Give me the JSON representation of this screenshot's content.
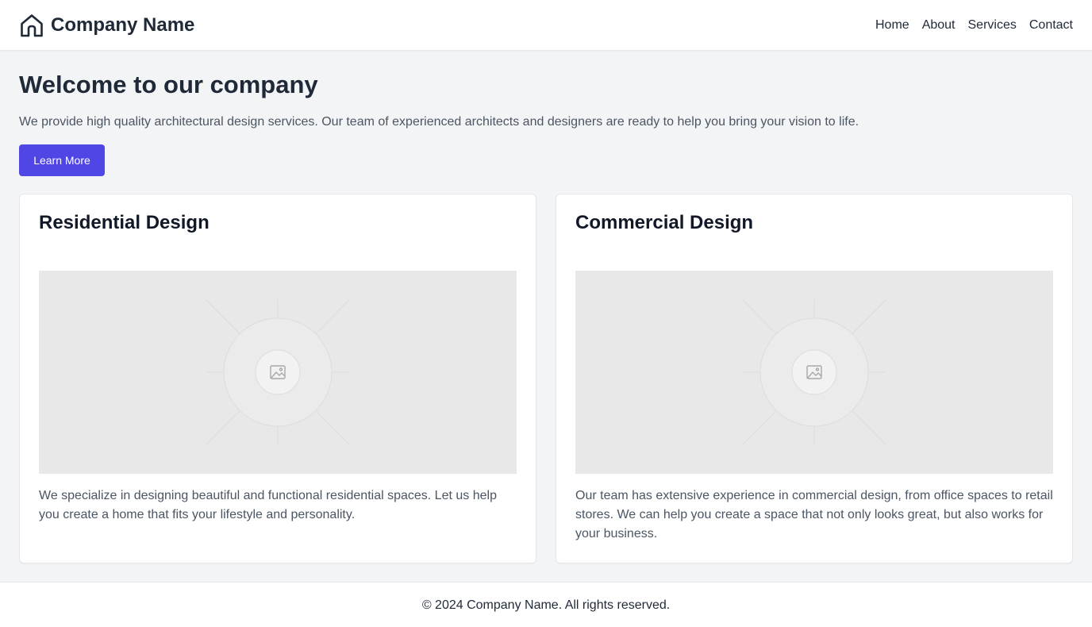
{
  "header": {
    "brand_name": "Company Name",
    "brand_icon": "home-icon",
    "nav": [
      {
        "label": "Home"
      },
      {
        "label": "About"
      },
      {
        "label": "Services"
      },
      {
        "label": "Contact"
      }
    ]
  },
  "hero": {
    "title": "Welcome to our company",
    "text": "We provide high quality architectural design services. Our team of experienced architects and designers are ready to help you bring your vision to life.",
    "button_label": "Learn More"
  },
  "cards": [
    {
      "title": "Residential Design",
      "image_icon": "image-placeholder-icon",
      "text": "We specialize in designing beautiful and functional residential spaces. Let us help you create a home that fits your lifestyle and personality."
    },
    {
      "title": "Commercial Design",
      "image_icon": "image-placeholder-icon",
      "text": "Our team has extensive experience in commercial design, from office spaces to retail stores. We can help you create a space that not only looks great, but also works for your business."
    }
  ],
  "footer": {
    "text": "© 2024 Company Name. All rights reserved."
  },
  "colors": {
    "accent": "#4f46e5",
    "background": "#f3f4f6",
    "surface": "#ffffff",
    "text": "#1f2937",
    "muted_text": "#4b5563",
    "placeholder": "#e8e8e8"
  }
}
